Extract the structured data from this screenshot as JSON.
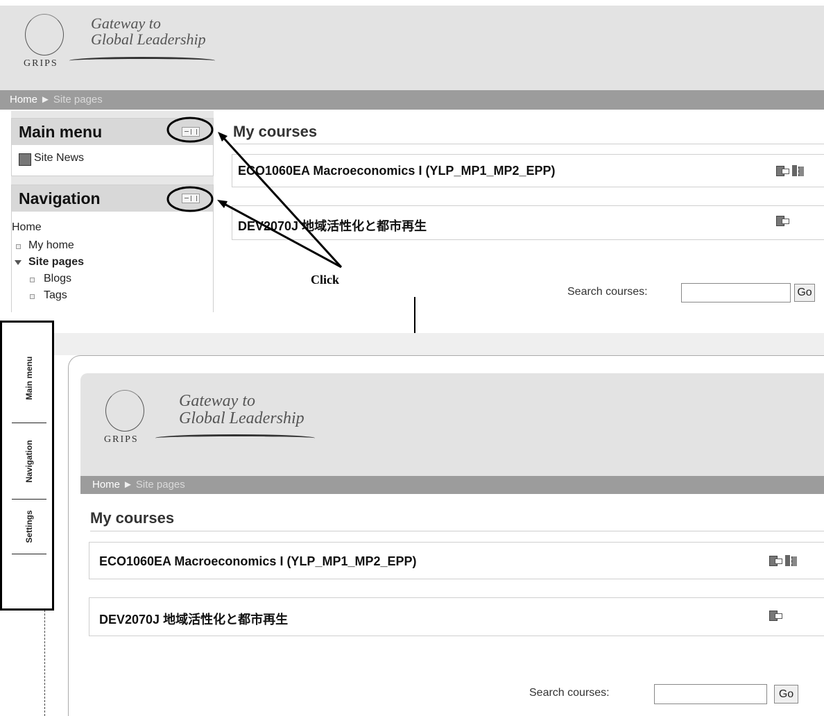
{
  "branding": {
    "org": "GRIPS",
    "tagline_line1": "Gateway to",
    "tagline_line2": "Global Leadership"
  },
  "breadcrumb": {
    "home": "Home",
    "separator": "►",
    "current": "Site pages"
  },
  "blocks": {
    "main_menu": {
      "title": "Main menu",
      "items": [
        "Site News"
      ]
    },
    "navigation": {
      "title": "Navigation",
      "items": [
        "Home",
        "My home",
        "Site pages",
        "Blogs",
        "Tags"
      ]
    }
  },
  "my_courses": {
    "title": "My courses",
    "courses": [
      {
        "name": "ECO1060EA Macroeconomics I (YLP_MP1_MP2_EPP)",
        "icons": [
          "enrol-icon",
          "guest-access-icon"
        ]
      },
      {
        "name": "DEV2070J 地域活性化と都市再生",
        "icons": [
          "enrol-icon"
        ]
      }
    ]
  },
  "search": {
    "label": "Search courses:",
    "value": "",
    "go_label": "Go"
  },
  "annotation": {
    "click_label": "Click"
  },
  "dock_tabs": [
    "Main menu",
    "Navigation",
    "Settings"
  ],
  "colors": {
    "header_bg": "#e3e3e3",
    "breadcrumb_bg": "#9c9c9c",
    "block_header_bg": "#d8d8d8",
    "annotation": "#000000"
  }
}
